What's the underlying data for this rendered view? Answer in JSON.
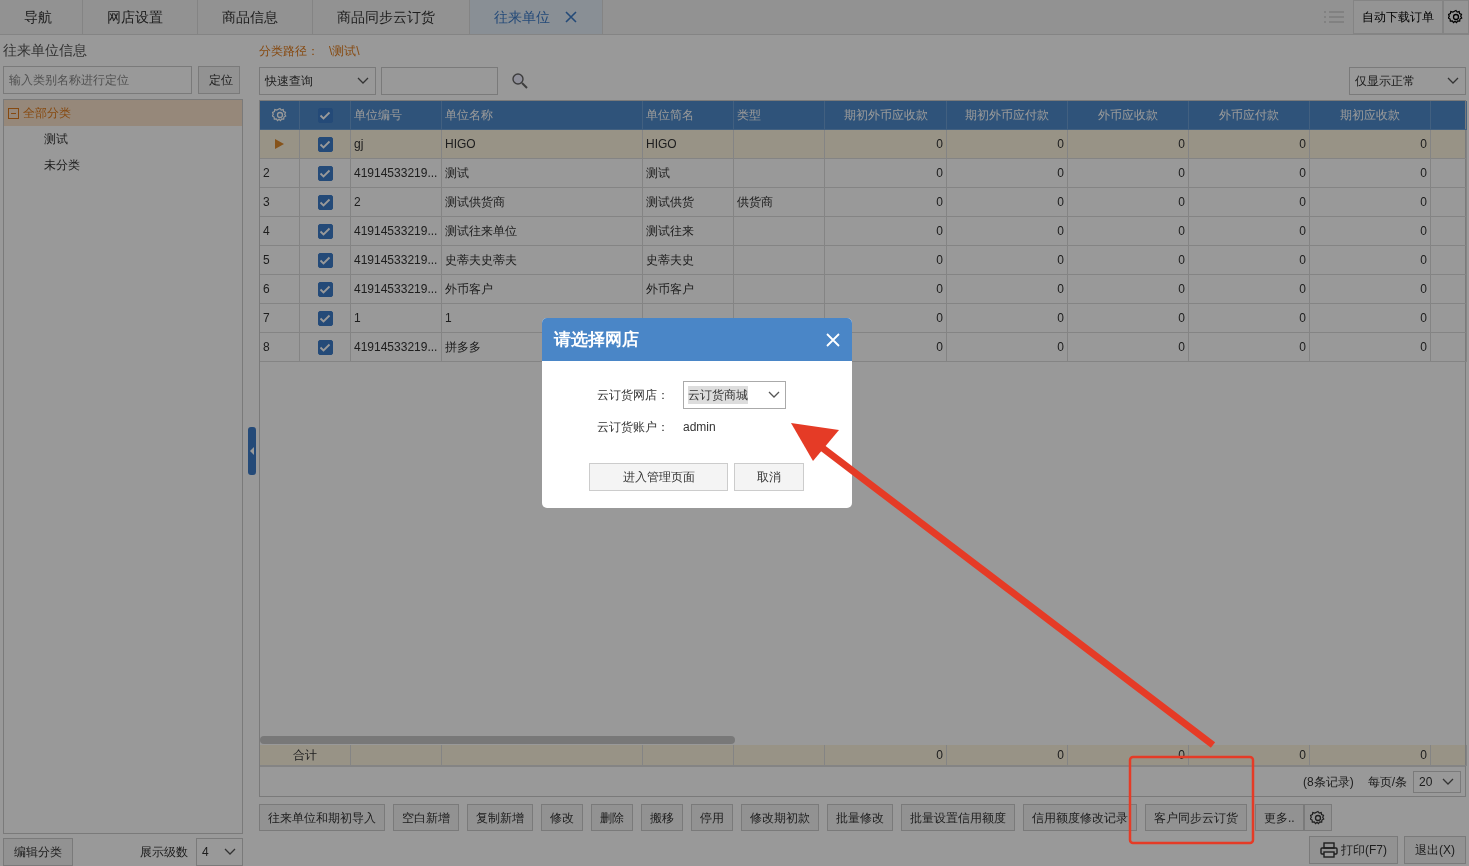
{
  "tabs": [
    {
      "label": "导航",
      "selected": false,
      "closable": false
    },
    {
      "label": "网店设置",
      "selected": false,
      "closable": false
    },
    {
      "label": "商品信息",
      "selected": false,
      "closable": false
    },
    {
      "label": "商品同步云订货",
      "selected": false,
      "closable": false
    },
    {
      "label": "往来单位",
      "selected": true,
      "closable": true
    }
  ],
  "top_right": {
    "auto_download_button": "自动下载订单"
  },
  "left_panel": {
    "title": "往来单位信息",
    "search": {
      "placeholder": "输入类别名称进行定位"
    },
    "locate_button": "定位",
    "tree": [
      {
        "label": "全部分类",
        "expanded": true,
        "selected": true,
        "children": [
          {
            "label": "测试",
            "selected": false
          },
          {
            "label": "未分类",
            "selected": false
          }
        ]
      }
    ],
    "edit_button": "编辑分类",
    "level_label": "展示级数",
    "level_value": "4"
  },
  "path": {
    "label": "分类路径：",
    "value": "\\测试\\"
  },
  "filter": {
    "query_select": "快速查询",
    "status_select": "仅显示正常"
  },
  "table": {
    "header_checked": true,
    "columns": [
      "单位编号",
      "单位名称",
      "单位简名",
      "类型",
      "期初外币应收款",
      "期初外币应付款",
      "外币应收款",
      "外币应付款",
      "期初应收款"
    ],
    "rows": [
      {
        "current": true,
        "checked": true,
        "code": "gj",
        "name": "HIGO",
        "short_name": "HIGO",
        "amounts": [
          "0",
          "0",
          "0",
          "0",
          "0"
        ]
      },
      {
        "current": false,
        "number": "2",
        "checked": true,
        "code": "41914533219...",
        "name": "测试",
        "short_name": "测试",
        "amounts": [
          "0",
          "0",
          "0",
          "0",
          "0"
        ]
      },
      {
        "current": false,
        "number": "3",
        "checked": true,
        "code": "2",
        "name": "测试供货商",
        "short_name": "测试供货",
        "type": "供货商",
        "amounts": [
          "0",
          "0",
          "0",
          "0",
          "0"
        ]
      },
      {
        "current": false,
        "number": "4",
        "checked": true,
        "code": "41914533219...",
        "name": "测试往来单位",
        "short_name": "测试往来",
        "amounts": [
          "0",
          "0",
          "0",
          "0",
          "0"
        ]
      },
      {
        "current": false,
        "number": "5",
        "checked": true,
        "code": "41914533219...",
        "name": "史蒂夫史蒂夫",
        "short_name": "史蒂夫史",
        "amounts": [
          "0",
          "0",
          "0",
          "0",
          "0"
        ]
      },
      {
        "current": false,
        "number": "6",
        "checked": true,
        "code": "41914533219...",
        "name": "外币客户",
        "short_name": "外币客户",
        "amounts": [
          "0",
          "0",
          "0",
          "0",
          "0"
        ]
      },
      {
        "current": false,
        "number": "7",
        "checked": true,
        "code": "1",
        "name": "1",
        "amounts": [
          "0",
          "0",
          "0",
          "0",
          "0"
        ]
      },
      {
        "current": false,
        "number": "8",
        "checked": true,
        "code": "41914533219...",
        "name": "拼多多",
        "amounts": [
          "0",
          "0",
          "0",
          "0",
          "0"
        ]
      }
    ],
    "totals": {
      "label": "合计",
      "amounts": [
        "0",
        "0",
        "0",
        "0",
        "0"
      ]
    }
  },
  "pager": {
    "record_count": "(8条记录)",
    "per_page_label": "每页/条",
    "per_page": "20"
  },
  "actions": [
    "往来单位和期初导入",
    "空白新增",
    "复制新增",
    "修改",
    "删除",
    "搬移",
    "停用",
    "修改期初款",
    "批量修改",
    "批量设置信用额度",
    "信用额度修改记录",
    "客户同步云订货"
  ],
  "more_button": "更多..",
  "print_button": "打印(F7)",
  "exit_button": "退出(X)",
  "dialog": {
    "title": "请选择网店",
    "fields": [
      {
        "kind": "select",
        "label": "云订货网店：",
        "value": "云订货商城"
      },
      {
        "kind": "text",
        "label": "云订货账户：",
        "value": "admin"
      }
    ],
    "buttons": [
      "进入管理页面",
      "取消"
    ]
  }
}
